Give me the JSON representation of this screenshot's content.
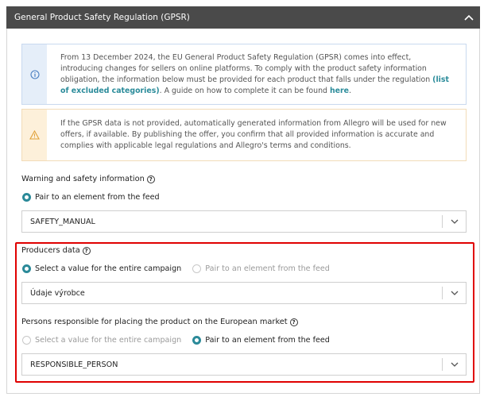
{
  "header": {
    "title": "General Product Safety Regulation (GPSR)"
  },
  "info_notice": {
    "icon": "info-icon",
    "text_before": "From 13 December 2024, the EU General Product Safety Regulation (GPSR) comes into effect, introducing changes for sellers on online platforms. To comply with the product safety information obligation, the information below must be provided for each product that falls under the regulation ",
    "link1": "(list of excluded categories)",
    "text_middle": ". A guide on how to complete it can be found ",
    "link2": "here",
    "text_after": "."
  },
  "warning_notice": {
    "icon": "warning-icon",
    "text": "If the GPSR data is not provided, automatically generated information from Allegro will be used for new offers, if available. By publishing the offer, you confirm that all provided information is accurate and complies with applicable legal regulations and Allegro's terms and conditions."
  },
  "warning_section": {
    "label": "Warning and safety information",
    "radio_feed": "Pair to an element from the feed",
    "selected": "SAFETY_MANUAL"
  },
  "producers_section": {
    "label": "Producers data",
    "radio_campaign": "Select a value for the entire campaign",
    "radio_feed": "Pair to an element from the feed",
    "selected": "Údaje výrobce"
  },
  "responsible_section": {
    "label": "Persons responsible for placing the product on the European market",
    "radio_campaign": "Select a value for the entire campaign",
    "radio_feed": "Pair to an element from the feed",
    "selected": "RESPONSIBLE_PERSON"
  },
  "colors": {
    "accent": "#2b8a99",
    "header_bg": "#4a4a4a",
    "highlight": "#e00000"
  }
}
